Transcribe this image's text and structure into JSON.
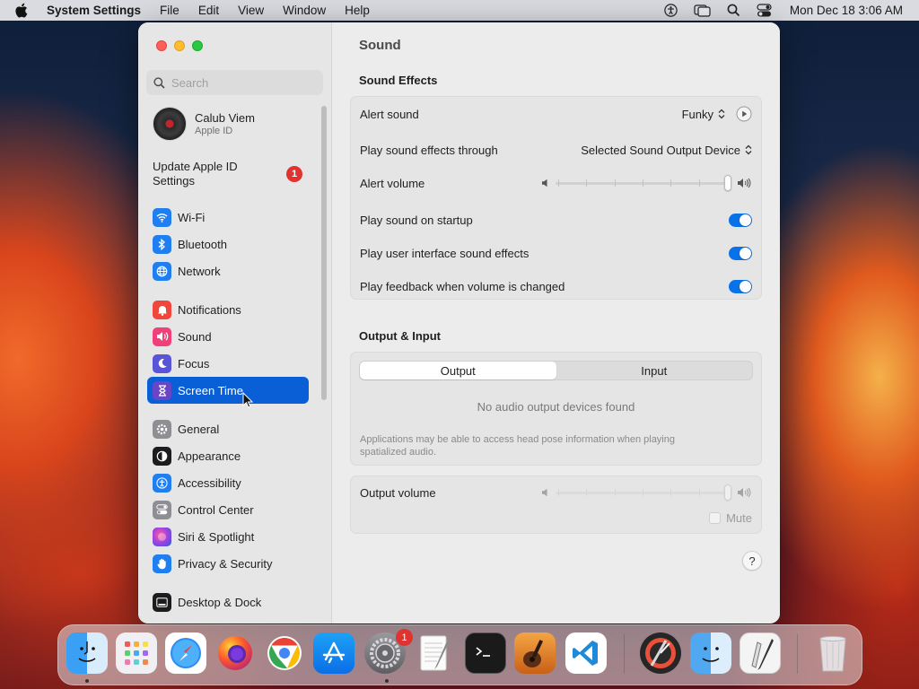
{
  "menubar": {
    "app_name": "System Settings",
    "items": [
      "File",
      "Edit",
      "View",
      "Window",
      "Help"
    ],
    "clock": "Mon Dec 18  3:06 AM"
  },
  "sidebar": {
    "search_placeholder": "Search",
    "account": {
      "name": "Calub Viem",
      "sub": "Apple ID"
    },
    "update": {
      "label": "Update Apple ID Settings",
      "badge": "1"
    },
    "items": [
      {
        "label": "Wi-Fi",
        "icon": "wifi-icon",
        "color": "#1f7ef0"
      },
      {
        "label": "Bluetooth",
        "icon": "bluetooth-icon",
        "color": "#1f7ef0"
      },
      {
        "label": "Network",
        "icon": "globe-icon",
        "color": "#1f7ef0"
      },
      {
        "label": "Notifications",
        "icon": "bell-icon",
        "color": "#f0473c"
      },
      {
        "label": "Sound",
        "icon": "speaker-icon",
        "color": "#f0407a"
      },
      {
        "label": "Focus",
        "icon": "moon-icon",
        "color": "#5856d6"
      },
      {
        "label": "Screen Time",
        "icon": "hourglass-icon",
        "color": "#6a45c8"
      },
      {
        "label": "General",
        "icon": "gear-icon",
        "color": "#8e8e93"
      },
      {
        "label": "Appearance",
        "icon": "appearance-icon",
        "color": "#1c1c1e"
      },
      {
        "label": "Accessibility",
        "icon": "accessibility-icon",
        "color": "#1f7ef0"
      },
      {
        "label": "Control Center",
        "icon": "control-center-icon",
        "color": "#8e8e93"
      },
      {
        "label": "Siri & Spotlight",
        "icon": "siri-icon",
        "color": "#b040d0"
      },
      {
        "label": "Privacy & Security",
        "icon": "hand-icon",
        "color": "#1f7ef0"
      },
      {
        "label": "Desktop & Dock",
        "icon": "dock-icon",
        "color": "#1c1c1e"
      }
    ],
    "selected": "Screen Time"
  },
  "content": {
    "title": "Sound",
    "sound_effects": {
      "heading": "Sound Effects",
      "alert_sound_label": "Alert sound",
      "alert_sound_value": "Funky",
      "play_through_label": "Play sound effects through",
      "play_through_value": "Selected Sound Output Device",
      "alert_volume_label": "Alert volume",
      "alert_volume_level": 1.0,
      "startup_label": "Play sound on startup",
      "startup_on": true,
      "ui_sounds_label": "Play user interface sound effects",
      "ui_sounds_on": true,
      "feedback_label": "Play feedback when volume is changed",
      "feedback_on": true
    },
    "output_input": {
      "heading": "Output & Input",
      "tabs": [
        "Output",
        "Input"
      ],
      "active_tab": "Output",
      "empty_message": "No audio output devices found",
      "note": "Applications may be able to access head pose information when playing spatialized audio.",
      "output_volume_label": "Output volume",
      "output_volume_level": 1.0,
      "mute_label": "Mute"
    },
    "help_label": "?"
  },
  "dock": {
    "apps": [
      {
        "name": "finder-icon",
        "running": true
      },
      {
        "name": "launchpad-icon",
        "running": false
      },
      {
        "name": "safari-icon",
        "running": false
      },
      {
        "name": "firefox-icon",
        "running": false
      },
      {
        "name": "chrome-icon",
        "running": false
      },
      {
        "name": "app-store-icon",
        "running": false
      },
      {
        "name": "system-settings-icon",
        "running": true,
        "badge": "1"
      },
      {
        "name": "textedit-icon",
        "running": false
      },
      {
        "name": "terminal-icon",
        "running": false
      },
      {
        "name": "garageband-icon",
        "running": false
      },
      {
        "name": "vscode-icon",
        "running": false
      },
      {
        "name": "instruments-icon",
        "running": false
      },
      {
        "name": "finder-alt-icon",
        "running": false
      },
      {
        "name": "script-editor-icon",
        "running": false
      },
      {
        "name": "trash-icon",
        "running": false
      }
    ]
  }
}
